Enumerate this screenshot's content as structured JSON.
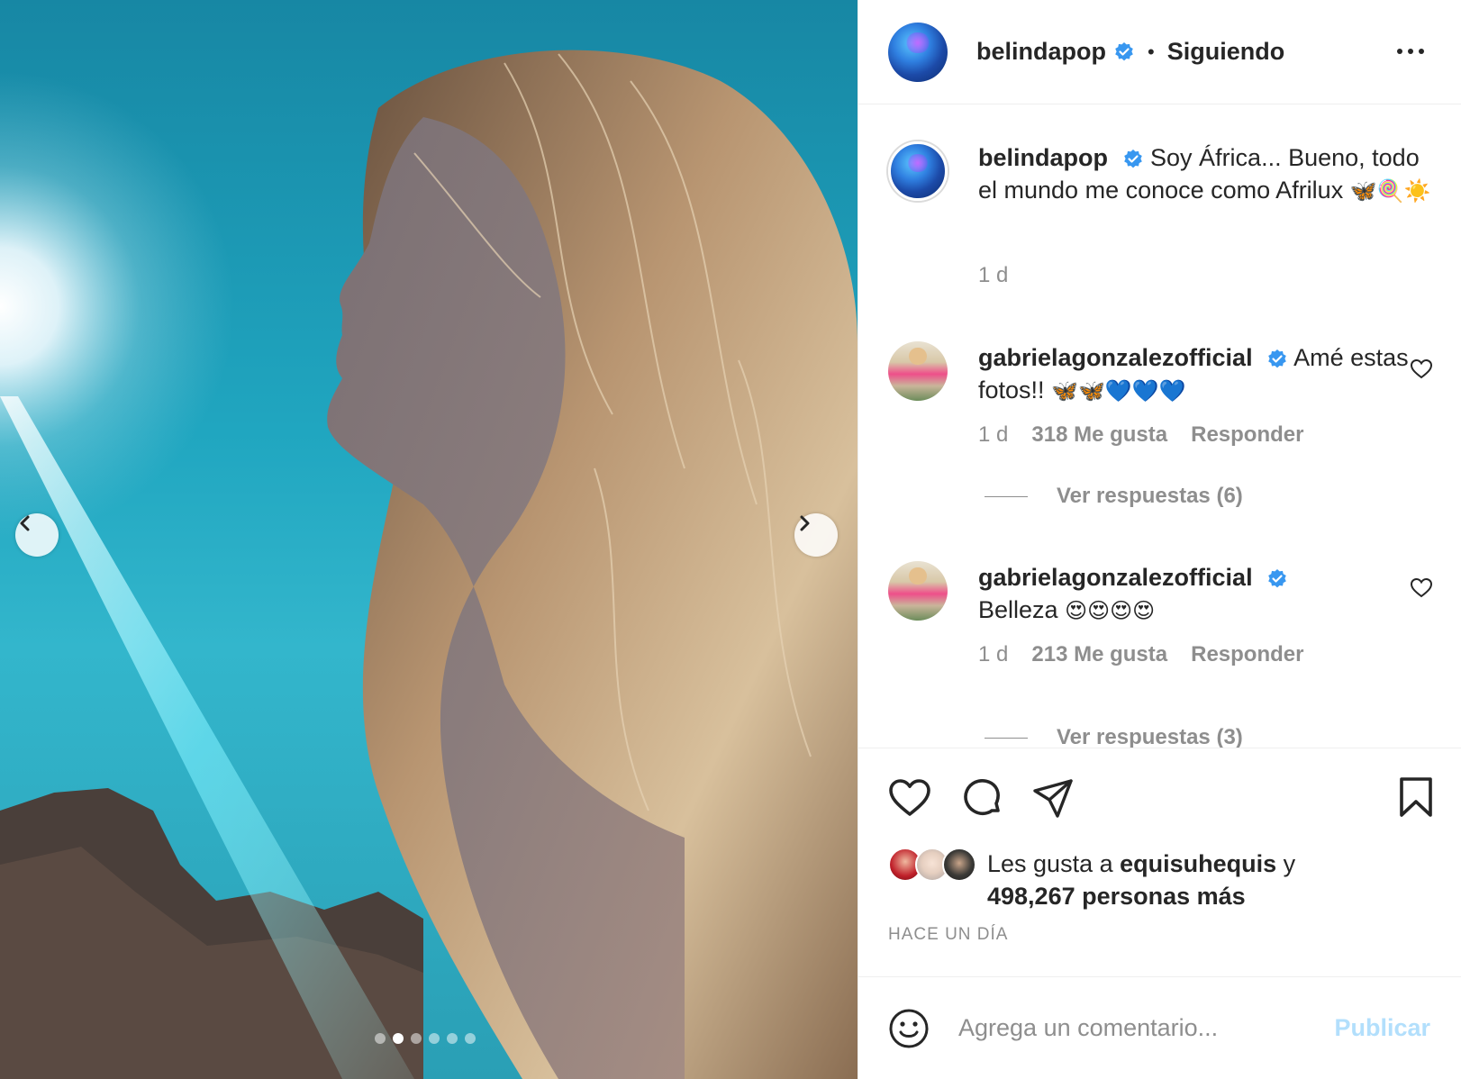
{
  "post": {
    "author": "belindapop",
    "follow_status": "Siguiendo",
    "separator": "•",
    "carousel": {
      "slide_count": 6,
      "active_slide": 2
    }
  },
  "caption": {
    "user": "belindapop",
    "text": "Soy África... Bueno, todo el mundo me conoce como Afrilux",
    "emojis": "🦋🍭☀️",
    "time": "1 d"
  },
  "comments": [
    {
      "user": "gabrielagonzalezofficial",
      "text": "Amé estas fotos!!",
      "emojis": "🦋🦋💙💙💙",
      "time": "1 d",
      "likes": "318 Me gusta",
      "reply_label": "Responder",
      "view_replies": "Ver respuestas (6)"
    },
    {
      "user": "gabrielagonzalezofficial",
      "text": "Belleza",
      "emojis": "😍😍😍😍",
      "time": "1 d",
      "likes": "213 Me gusta",
      "reply_label": "Responder",
      "view_replies": "Ver respuestas (3)"
    }
  ],
  "likes": {
    "prefix": "Les gusta a",
    "user": "equisuhequis",
    "connector": "y",
    "count_text": "498,267 personas más"
  },
  "timestamp": "HACE UN DÍA",
  "comment_box": {
    "placeholder": "Agrega un comentario...",
    "publish_label": "Publicar"
  },
  "icons": {
    "verified": "verified-badge-icon",
    "more": "more-options-icon",
    "like": "heart-icon",
    "comment": "comment-icon",
    "share": "send-icon",
    "save": "bookmark-icon",
    "emoji": "emoji-icon"
  },
  "colors": {
    "verified_blue": "#3897f0",
    "muted_text": "#8e8e8e",
    "publish_disabled": "#b2dffc"
  }
}
